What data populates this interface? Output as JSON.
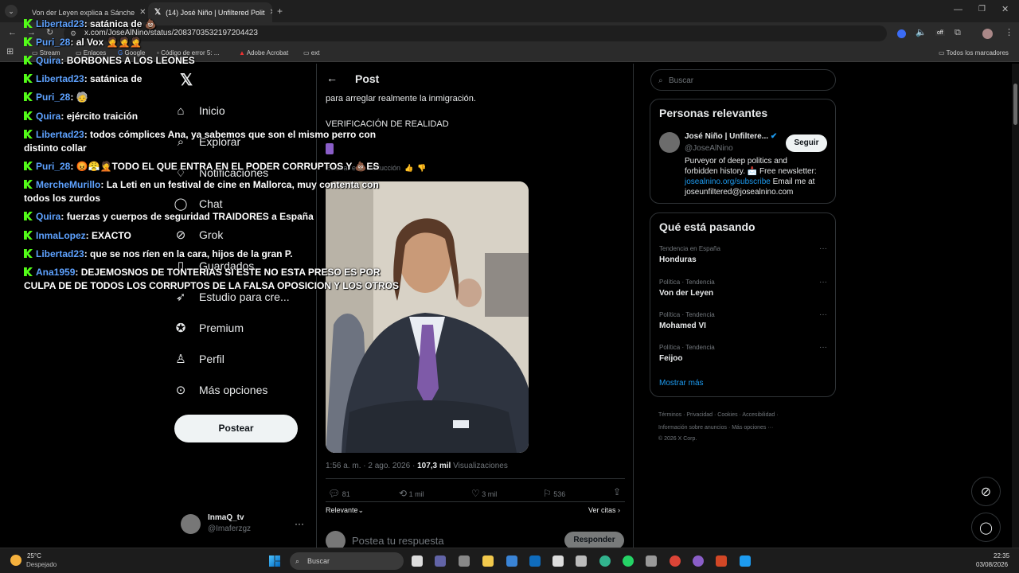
{
  "browser": {
    "tabs": [
      {
        "title": "Von der Leyen explica a Sánche",
        "active": false
      },
      {
        "title": "(14) José Niño | Unfiltered Polit",
        "active": true
      }
    ],
    "url": "x.com/JoseAlNino/status/2083703532197204423",
    "bookmarks": [
      "Stream",
      "Enlaces",
      "Google",
      "Código de error 5: ...",
      "Adobe Acrobat",
      "ext"
    ],
    "all_bookmarks": "Todos los marcadores"
  },
  "nav": {
    "items": [
      "Inicio",
      "Explorar",
      "Notificaciones",
      "Chat",
      "Grok",
      "Guardados",
      "Estudio para cre...",
      "Premium",
      "Perfil",
      "Más opciones"
    ],
    "post_button": "Postear",
    "account_name": "InmaQ_tv",
    "account_handle": "@Imaferzgz"
  },
  "post": {
    "header": "Post",
    "text1": "para arreglar realmente la inmigración.",
    "text2": "VERIFICACIÓN DE REALIDAD",
    "translate": "Evaluar esta traducción",
    "timestamp": "1:56 a. m. · 2 ago. 2026 · ",
    "views_count": "107,3 mil",
    "views_label": " Visualizaciones",
    "replies": "81",
    "reposts": "1 mil",
    "likes": "3 mil",
    "bookmarks": "536",
    "sort": "Relevante",
    "quotes": "Ver citas",
    "reply_placeholder": "Postea tu respuesta",
    "reply_button": "Responder"
  },
  "search": {
    "placeholder": "Buscar"
  },
  "relevant": {
    "title": "Personas relevantes",
    "name": "José Niño | Unfiltere...",
    "handle": "@JoseAlNino",
    "follow": "Seguir",
    "bio1": "Purveyor of deep politics and",
    "bio2": "forbidden history. 📩 Free newsletter:",
    "bio_link": "josealnino.org/subscribe",
    "bio3": " Email me at",
    "bio4": "joseunfiltered@josealnino.com"
  },
  "trends": {
    "title": "Qué está pasando",
    "items": [
      {
        "context": "Tendencia en España",
        "name": "Honduras"
      },
      {
        "context": "Política · Tendencia",
        "name": "Von der Leyen"
      },
      {
        "context": "Política · Tendencia",
        "name": "Mohamed VI"
      },
      {
        "context": "Política · Tendencia",
        "name": "Feijoo"
      }
    ],
    "more": "Mostrar más"
  },
  "footer": {
    "links1": "Términos · Privacidad · Cookies · Accesibilidad ·",
    "links2": "Información sobre anuncios · Más opciones ···",
    "copyright": "© 2026 X Corp."
  },
  "chat": [
    {
      "user": "Libertad23",
      "msg": "satánica de 💩"
    },
    {
      "user": "Puri_28",
      "msg": "al Vox 🤦🤦🤦"
    },
    {
      "user": "Quira",
      "msg": "BORBONES A LOS LEONES"
    },
    {
      "user": "Libertad23",
      "msg": "satánica de"
    },
    {
      "user": "Puri_28",
      "msg": "🧓"
    },
    {
      "user": "Quira",
      "msg": "ejército traición"
    },
    {
      "user": "Libertad23",
      "msg": "todos cómplices Ana, ya sabemos que son el mismo perro con",
      "msg2": "distinto collar"
    },
    {
      "user": "Puri_28",
      "msg": "😡😤🤦TODO EL QUE ENTRA EN EL PODER CORRUPTOS Y 💩ES"
    },
    {
      "user": "MercheMurillo",
      "msg": "La Leti en un festival de cine en Mallorca, muy contenta con",
      "msg2": "todos los zurdos"
    },
    {
      "user": "Quira",
      "msg": "fuerzas y cuerpos de seguridad TRAIDORES a España"
    },
    {
      "user": "InmaLopez",
      "msg": "EXACTO"
    },
    {
      "user": "Libertad23",
      "msg": "que se nos ríen en la cara, hijos de la gran P."
    },
    {
      "user": "Ana1959",
      "msg": "DEJEMOSNOS DE TONTERIAS SI ESTE NO ESTA PRESO ES POR",
      "msg2": "CULPA DE DE TODOS LOS CORRUPTOS DE LA FALSA OPOSICION Y LOS OTROS"
    }
  ],
  "taskbar": {
    "temp": "25°C",
    "weather": "Despejado",
    "search": "Buscar",
    "time": "22:35",
    "date": "03/08/2026"
  }
}
